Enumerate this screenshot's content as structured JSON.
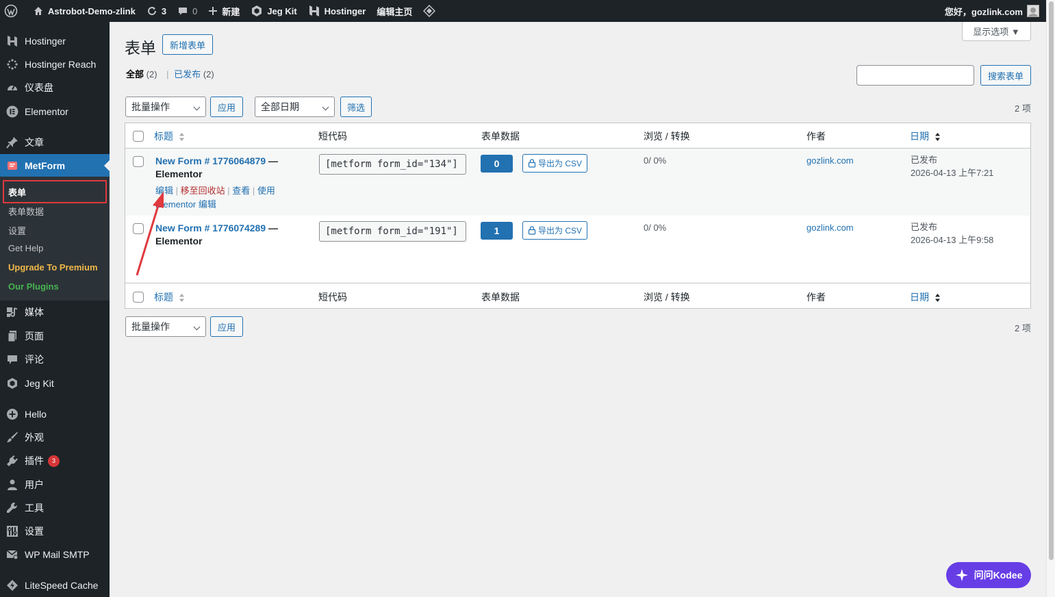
{
  "adminbar": {
    "site_name": "Astrobot-Demo-zlink",
    "updates_count": "3",
    "comments_count": "0",
    "new_label": "新建",
    "jegkit_label": "Jeg Kit",
    "hostinger_label": "Hostinger",
    "edit_home_label": "编辑主页",
    "greeting": "您好，gozlink.com"
  },
  "sidebar": {
    "items": [
      {
        "label": "Hostinger",
        "icon": "hostinger-icon"
      },
      {
        "label": "Hostinger Reach",
        "icon": "reach-icon"
      },
      {
        "label": "仪表盘",
        "icon": "dashboard-icon"
      },
      {
        "label": "Elementor",
        "icon": "elementor-icon"
      },
      {
        "label": "文章",
        "icon": "pin-icon"
      },
      {
        "label": "MetForm",
        "icon": "metform-icon"
      },
      {
        "label": "媒体",
        "icon": "media-icon"
      },
      {
        "label": "页面",
        "icon": "page-icon"
      },
      {
        "label": "评论",
        "icon": "comment-icon"
      },
      {
        "label": "Jeg Kit",
        "icon": "jegkit-icon"
      },
      {
        "label": "Hello",
        "icon": "plus-circle-icon"
      },
      {
        "label": "外观",
        "icon": "brush-icon"
      },
      {
        "label": "插件",
        "icon": "plugin-icon",
        "badge": "3"
      },
      {
        "label": "用户",
        "icon": "user-icon"
      },
      {
        "label": "工具",
        "icon": "wrench-icon"
      },
      {
        "label": "设置",
        "icon": "settings-icon"
      },
      {
        "label": "WP Mail SMTP",
        "icon": "mail-icon"
      },
      {
        "label": "LiteSpeed Cache",
        "icon": "litespeed-icon"
      }
    ],
    "submenu": [
      {
        "label": "表单"
      },
      {
        "label": "表单数据"
      },
      {
        "label": "设置"
      },
      {
        "label": "Get Help"
      },
      {
        "label": "Upgrade To Premium",
        "color": "#f0b849"
      },
      {
        "label": "Our Plugins",
        "color": "#46b450"
      }
    ]
  },
  "page": {
    "title": "表单",
    "add_new": "新增表单",
    "screen_options": "显示选项 ▼",
    "filters": {
      "all": "全部",
      "all_count": "(2)",
      "separator": "|",
      "published": "已发布",
      "published_count": "(2)"
    },
    "search_button": "搜索表单",
    "bulk_action": "批量操作",
    "apply": "应用",
    "date_filter": "全部日期",
    "filter_button": "筛选",
    "items_count": "2 项"
  },
  "table": {
    "columns": [
      "标题",
      "短代码",
      "表单数据",
      "浏览 / 转换",
      "作者",
      "日期"
    ],
    "rows": [
      {
        "title": "New Form # 1776064879",
        "suffix": " — Elementor",
        "actions": [
          "编辑",
          "移至回收站",
          "查看",
          "使用"
        ],
        "actions_line2": "Elementor 编辑",
        "shortcode": "[metform form_id=\"134\"]",
        "entries": "0",
        "export": "导出为 CSV",
        "views": "0/ 0%",
        "author": "gozlink.com",
        "status": "已发布",
        "date": "2026-04-13 上午7:21"
      },
      {
        "title": "New Form # 1776074289",
        "suffix": " — Elementor",
        "shortcode": "[metform form_id=\"191\"]",
        "entries": "1",
        "export": "导出为 CSV",
        "views": "0/ 0%",
        "author": "gozlink.com",
        "status": "已发布",
        "date": "2026-04-13 上午9:58"
      }
    ]
  },
  "kodee": {
    "label": "问问Kodee"
  },
  "colors": {
    "admin_dark": "#1d2327",
    "primary": "#2271b1",
    "highlight": "#e0393e",
    "kodee": "#673de6"
  }
}
